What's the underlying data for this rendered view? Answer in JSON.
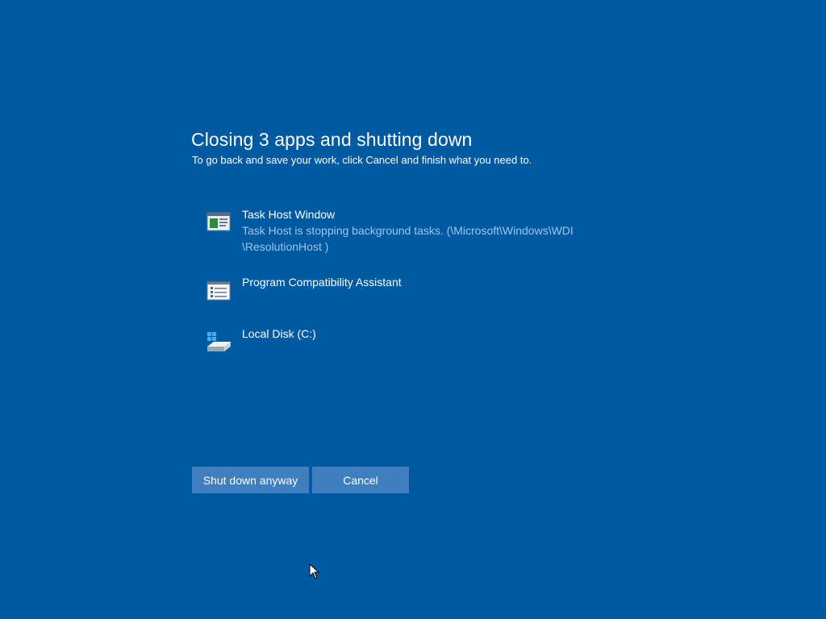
{
  "dialog": {
    "title": "Closing 3 apps and shutting down",
    "subtitle": "To go back and save your work, click Cancel and finish what you need to."
  },
  "apps": [
    {
      "name": "Task Host Window",
      "status_line1": "Task Host is stopping background tasks. (\\Microsoft\\Windows\\WDI",
      "status_line2": "\\ResolutionHost )",
      "icon": "window-icon"
    },
    {
      "name": "Program Compatibility Assistant",
      "icon": "list-window-icon"
    },
    {
      "name": "Local Disk (C:)",
      "icon": "drive-icon"
    }
  ],
  "buttons": {
    "shutdown_label": "Shut down anyway",
    "cancel_label": "Cancel"
  },
  "colors": {
    "background": "#005aa1",
    "button": "#3f7fbf",
    "status_text": "#9dc6ea"
  }
}
